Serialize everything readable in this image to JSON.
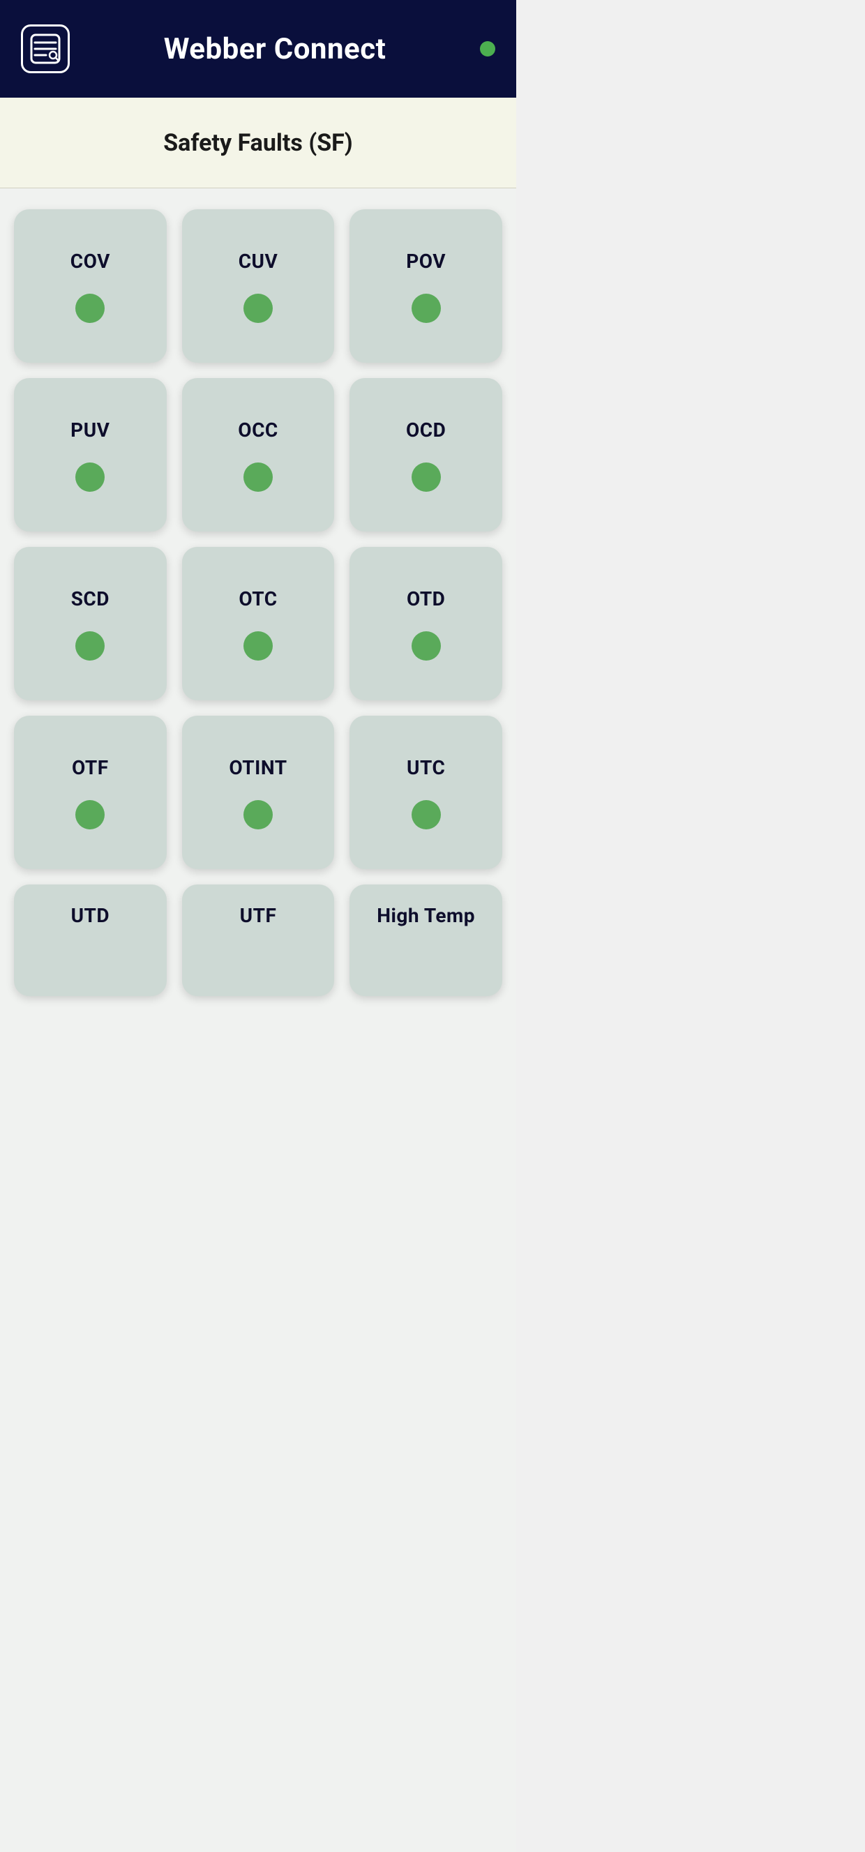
{
  "header": {
    "title": "Webber Connect",
    "status_dot_color": "#4caf50",
    "logo_alt": "Webber Connect logo"
  },
  "subtitle": {
    "text": "Safety Faults (SF)"
  },
  "fault_cards": [
    {
      "id": "cov",
      "label": "COV",
      "status": "ok",
      "dot_color": "#5aaa5a"
    },
    {
      "id": "cuv",
      "label": "CUV",
      "status": "ok",
      "dot_color": "#5aaa5a"
    },
    {
      "id": "pov",
      "label": "POV",
      "status": "ok",
      "dot_color": "#5aaa5a"
    },
    {
      "id": "puv",
      "label": "PUV",
      "status": "ok",
      "dot_color": "#5aaa5a"
    },
    {
      "id": "occ",
      "label": "OCC",
      "status": "ok",
      "dot_color": "#5aaa5a"
    },
    {
      "id": "ocd",
      "label": "OCD",
      "status": "ok",
      "dot_color": "#5aaa5a"
    },
    {
      "id": "scd",
      "label": "SCD",
      "status": "ok",
      "dot_color": "#5aaa5a"
    },
    {
      "id": "otc",
      "label": "OTC",
      "status": "ok",
      "dot_color": "#5aaa5a"
    },
    {
      "id": "otd",
      "label": "OTD",
      "status": "ok",
      "dot_color": "#5aaa5a"
    },
    {
      "id": "otf",
      "label": "OTF",
      "status": "ok",
      "dot_color": "#5aaa5a"
    },
    {
      "id": "otint",
      "label": "OTINT",
      "status": "ok",
      "dot_color": "#5aaa5a"
    },
    {
      "id": "utc",
      "label": "UTC",
      "status": "ok",
      "dot_color": "#5aaa5a"
    },
    {
      "id": "utd",
      "label": "UTD",
      "status": "ok",
      "dot_color": "#5aaa5a"
    },
    {
      "id": "utf",
      "label": "UTF",
      "status": "ok",
      "dot_color": "#5aaa5a"
    },
    {
      "id": "high-temp",
      "label": "High Temp",
      "status": "ok",
      "dot_color": "#5aaa5a"
    }
  ]
}
